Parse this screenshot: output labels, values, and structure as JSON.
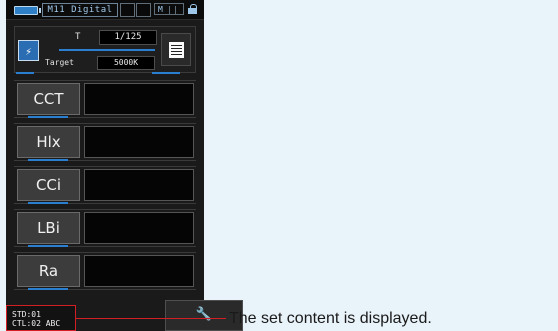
{
  "status_bar": {
    "mode": "M11 Digital",
    "signal": "M"
  },
  "exposure": {
    "t_label": "T",
    "t_value": "1/125",
    "target_label": "Target",
    "target_value": "5000K"
  },
  "measurements": [
    {
      "label": "CCT",
      "value": ""
    },
    {
      "label": "Hlx",
      "value": ""
    },
    {
      "label": "CCi",
      "value": ""
    },
    {
      "label": "LBi",
      "value": ""
    },
    {
      "label": "Ra",
      "value": ""
    }
  ],
  "footer": {
    "std_line1": "STD:01",
    "std_line2": "CTL:02 ABC",
    "settings_icon": "wrench-icon"
  },
  "annotation": {
    "text": "The set content is displayed.",
    "color": "#d21f26"
  },
  "colors": {
    "accent": "#2a7fd0",
    "device_bg": "#1a1a1a",
    "page_bg": "#e9f3fa"
  }
}
